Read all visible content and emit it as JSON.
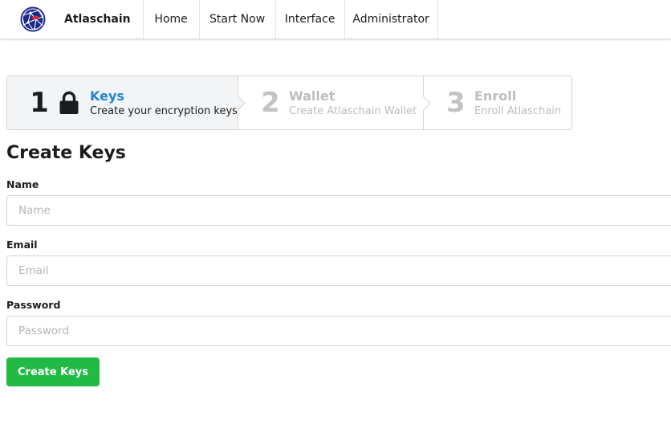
{
  "nav": {
    "brand": "Atlaschain",
    "brand_icon": "atlaschain-globe-logo",
    "items": [
      {
        "label": "Home"
      },
      {
        "label": "Start Now"
      },
      {
        "label": "Interface"
      },
      {
        "label": "Administrator"
      }
    ]
  },
  "steps": [
    {
      "number": "1",
      "title": "Keys",
      "description": "Create your encryption keys",
      "icon": "lock-icon",
      "state": "active"
    },
    {
      "number": "2",
      "title": "Wallet",
      "description": "Create Atlaschain Wallet",
      "state": "disabled"
    },
    {
      "number": "3",
      "title": "Enroll",
      "description": "Enroll Atlaschain",
      "state": "disabled"
    }
  ],
  "form": {
    "title": "Create Keys",
    "name": {
      "label": "Name",
      "placeholder": "Name",
      "value": ""
    },
    "email": {
      "label": "Email",
      "placeholder": "Email",
      "value": ""
    },
    "password": {
      "label": "Password",
      "placeholder": "Password",
      "value": ""
    },
    "submit_label": "Create Keys"
  },
  "colors": {
    "active_step_title": "#2185d0",
    "submit_button": "#21ba45",
    "logo_blue": "#1a2a8c",
    "logo_red": "#e0262e"
  }
}
